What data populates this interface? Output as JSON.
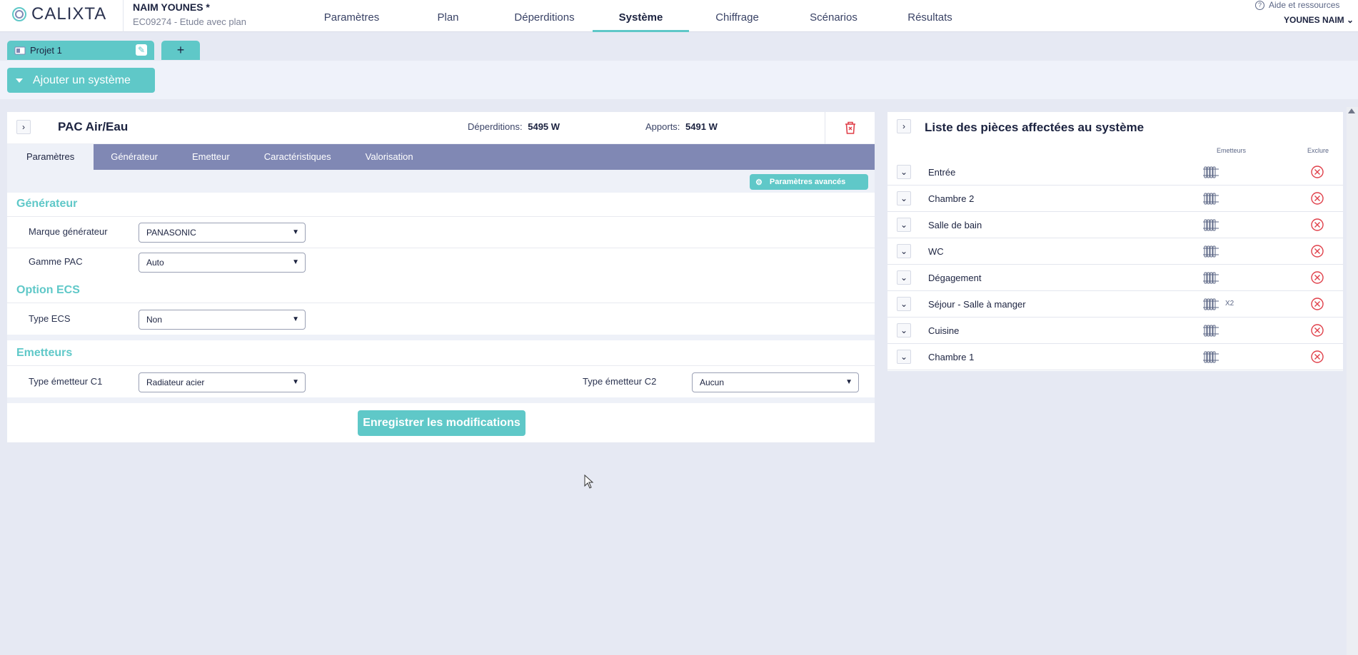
{
  "header": {
    "logo": "CALIXTA",
    "project_name": "NAIM YOUNES *",
    "project_sub": "EC09274 - Etude avec plan",
    "nav": [
      {
        "label": "Paramètres",
        "active": false
      },
      {
        "label": "Plan",
        "active": false
      },
      {
        "label": "Déperditions",
        "active": false
      },
      {
        "label": "Système",
        "active": true
      },
      {
        "label": "Chiffrage",
        "active": false
      },
      {
        "label": "Scénarios",
        "active": false
      },
      {
        "label": "Résultats",
        "active": false
      }
    ],
    "help": "Aide et ressources",
    "user": "YOUNES NAIM"
  },
  "project_tabs": {
    "tab_label": "Projet 1",
    "add_label": "+"
  },
  "add_system": "Ajouter un système",
  "system": {
    "name": "PAC Air/Eau",
    "deperditions_label": "Déperditions:",
    "deperditions_value": "5495 W",
    "apports_label": "Apports:",
    "apports_value": "5491 W",
    "tabs": [
      "Paramètres",
      "Générateur",
      "Emetteur",
      "Caractéristiques",
      "Valorisation"
    ],
    "advanced": "Paramètres avancés",
    "sections": {
      "generateur": "Générateur",
      "ecs": "Option ECS",
      "emetteurs": "Emetteurs"
    },
    "fields": {
      "marque_label": "Marque générateur",
      "marque_value": "PANASONIC",
      "gamme_label": "Gamme PAC",
      "gamme_value": "Auto",
      "ecs_label": "Type ECS",
      "ecs_value": "Non",
      "c1_label": "Type émetteur C1",
      "c1_value": "Radiateur acier",
      "c2_label": "Type émetteur C2",
      "c2_value": "Aucun"
    },
    "save": "Enregistrer les modifications"
  },
  "rooms": {
    "title": "Liste des pièces affectées au système",
    "col_emetteurs": "Emetteurs",
    "col_exclure": "Exclure",
    "items": [
      {
        "label": "Entrée",
        "count": ""
      },
      {
        "label": "Chambre 2",
        "count": ""
      },
      {
        "label": "Salle de bain",
        "count": ""
      },
      {
        "label": "WC",
        "count": ""
      },
      {
        "label": "Dégagement",
        "count": ""
      },
      {
        "label": "Séjour - Salle à manger",
        "count": "X2"
      },
      {
        "label": "Cuisine",
        "count": ""
      },
      {
        "label": "Chambre 1",
        "count": ""
      }
    ]
  },
  "colors": {
    "accent": "#5fc8c8",
    "tabbar": "#8088b4",
    "danger": "#e0404a",
    "text": "#1c2340"
  }
}
